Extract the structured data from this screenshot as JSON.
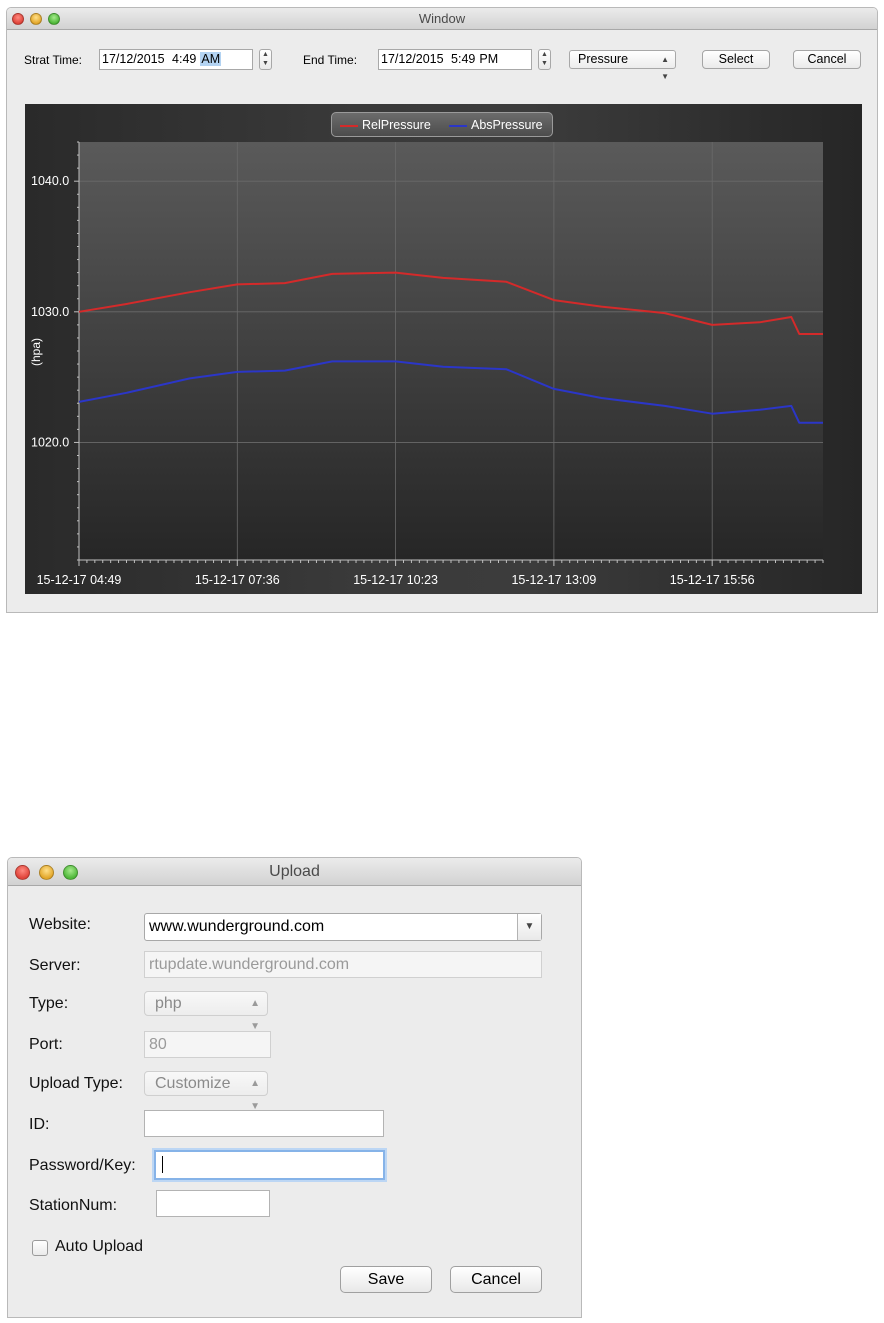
{
  "window1": {
    "title": "Window",
    "start_label": "Strat Time:",
    "start_date": "17/12/2015",
    "start_time": "4:49",
    "start_ampm": "AM",
    "end_label": "End Time:",
    "end_date": "17/12/2015",
    "end_time": "5:49",
    "end_ampm": "PM",
    "sensor_selected": "Pressure",
    "select_label": "Select",
    "cancel_label": "Cancel"
  },
  "chart_data": {
    "type": "line",
    "title": "",
    "xlabel": "",
    "ylabel": "(hpa)",
    "ylim": [
      1011,
      1043
    ],
    "y_ticks": [
      1040.0,
      1030.0,
      1020.0
    ],
    "y_tick_labels": [
      "1040.0",
      "1030.0",
      "1020.0"
    ],
    "x_tick_labels": [
      "15-12-17 04:49",
      "15-12-17 07:36",
      "15-12-17 10:23",
      "15-12-17 13:09",
      "15-12-17 15:56"
    ],
    "x_tick_positions": [
      0,
      1,
      2,
      3,
      4
    ],
    "xlim": [
      0,
      4.7
    ],
    "grid": true,
    "legend": "top-center",
    "series": [
      {
        "name": "RelPressure",
        "color": "#d42a2a",
        "x": [
          0,
          0.3,
          0.7,
          1.0,
          1.3,
          1.6,
          2.0,
          2.3,
          2.7,
          3.0,
          3.3,
          3.7,
          4.0,
          4.3,
          4.5,
          4.55,
          4.7
        ],
        "y": [
          1030.0,
          1030.6,
          1031.5,
          1032.1,
          1032.2,
          1032.9,
          1033.0,
          1032.6,
          1032.3,
          1030.9,
          1030.4,
          1029.9,
          1029.0,
          1029.2,
          1029.6,
          1028.3,
          1028.3
        ]
      },
      {
        "name": "AbsPressure",
        "color": "#2b36c8",
        "x": [
          0,
          0.3,
          0.7,
          1.0,
          1.3,
          1.6,
          2.0,
          2.3,
          2.7,
          3.0,
          3.3,
          3.7,
          4.0,
          4.3,
          4.5,
          4.55,
          4.7
        ],
        "y": [
          1023.1,
          1023.8,
          1024.9,
          1025.4,
          1025.5,
          1026.2,
          1026.2,
          1025.8,
          1025.6,
          1024.1,
          1023.4,
          1022.8,
          1022.2,
          1022.5,
          1022.8,
          1021.5,
          1021.5
        ]
      }
    ]
  },
  "window2": {
    "title": "Upload",
    "website_label": "Website:",
    "website_value": "www.wunderground.com",
    "server_label": "Server:",
    "server_value": "rtupdate.wunderground.com",
    "type_label": "Type:",
    "type_value": "php",
    "port_label": "Port:",
    "port_value": "80",
    "upload_type_label": "Upload Type:",
    "upload_type_value": "Customize",
    "id_label": "ID:",
    "id_value": "",
    "password_label": "Password/Key:",
    "password_value": "",
    "station_label": "StationNum:",
    "station_value": "",
    "auto_upload_label": "Auto Upload",
    "auto_upload_checked": false,
    "save_label": "Save",
    "cancel_label": "Cancel"
  }
}
